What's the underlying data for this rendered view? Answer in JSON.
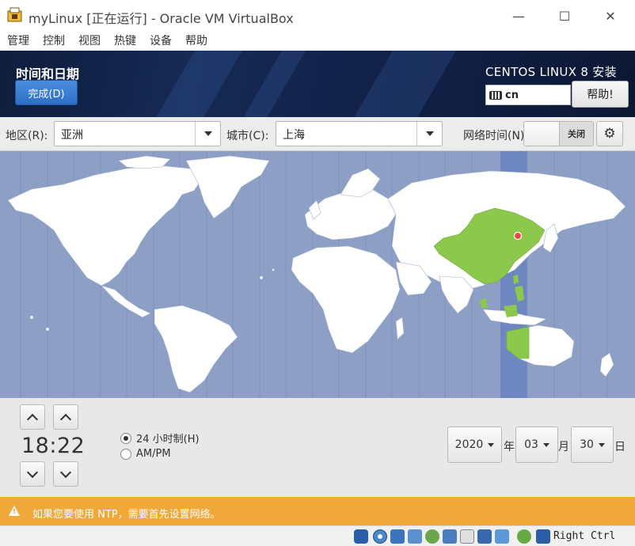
{
  "window": {
    "title": "myLinux [正在运行] - Oracle VM VirtualBox",
    "minimize": "—",
    "maximize": "☐",
    "close": "✕"
  },
  "menu": [
    "管理",
    "控制",
    "视图",
    "热键",
    "设备",
    "帮助"
  ],
  "header": {
    "title": "时间和日期",
    "done_label": "完成(D)",
    "installer_title": "CENTOS LINUX 8 安装",
    "keyboard_layout": "cn",
    "help_label": "帮助!"
  },
  "filters": {
    "region_label": "地区(R):",
    "region_value": "亚洲",
    "city_label": "城市(C):",
    "city_value": "上海",
    "ntp_label": "网络时间(N)",
    "ntp_state": "关闭",
    "settings_icon": "gear-icon"
  },
  "map": {
    "selected_timezone": "Asia/Shanghai",
    "colors": {
      "ocean": "#8e9fc6",
      "land": "#ffffff",
      "highlight": "#8cc84b",
      "band": "#6f87c0",
      "pin": "#e44"
    }
  },
  "time": {
    "value": "18:22",
    "format_24h_label": "24 小时制(H)",
    "format_ampm_label": "AM/PM",
    "format_selected": "24h"
  },
  "date": {
    "year": "2020",
    "year_unit": "年",
    "month": "03",
    "month_unit": "月",
    "day": "30",
    "day_unit": "日"
  },
  "warning": {
    "text": "如果您要使用 NTP，需要首先设置网络。"
  },
  "statusbar": {
    "host_key": "Right Ctrl"
  }
}
